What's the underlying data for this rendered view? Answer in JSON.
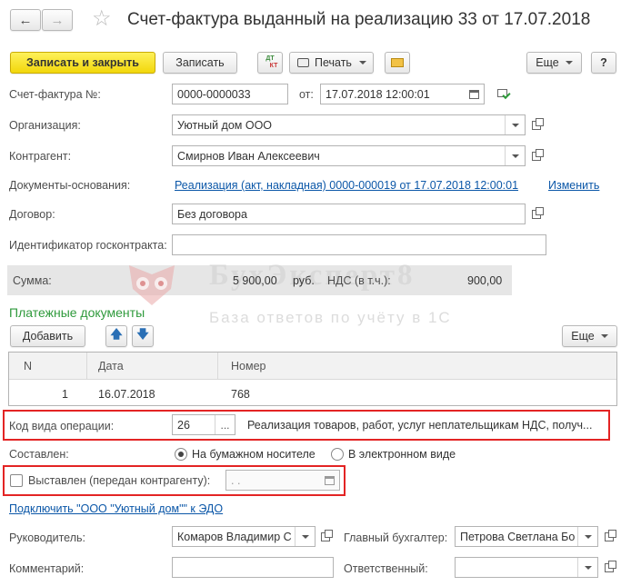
{
  "window": {
    "title": "Счет-фактура выданный на реализацию 33 от 17.07.2018"
  },
  "toolbar": {
    "save_close": "Записать и закрыть",
    "save": "Записать",
    "dt_kt_top": "ДТ",
    "dt_kt_bottom": "КТ",
    "print": "Печать",
    "more": "Еще",
    "help": "?"
  },
  "form": {
    "invoice_label": "Счет-фактура №:",
    "invoice_number": "0000-0000033",
    "date_label": "от:",
    "date_value": "17.07.2018 12:00:01",
    "org_label": "Организация:",
    "org_value": "Уютный дом ООО",
    "counterparty_label": "Контрагент:",
    "counterparty_value": "Смирнов Иван Алексеевич",
    "base_docs_label": "Документы-основания:",
    "base_docs_link": "Реализация (акт, накладная) 0000-000019 от 17.07.2018 12:00:01",
    "change_link": "Изменить",
    "contract_label": "Договор:",
    "contract_value": "Без договора",
    "gov_contract_label": "Идентификатор госконтракта:",
    "gov_contract_value": "",
    "sum_label": "Сумма:",
    "sum_value": "5 900,00",
    "sum_currency": "руб.",
    "vat_label": "НДС (в т.ч.):",
    "vat_value": "900,00"
  },
  "watermark": {
    "brand": "БухЭксперт8",
    "tagline": "База ответов по учёту в 1С"
  },
  "payments": {
    "title": "Платежные документы",
    "add": "Добавить",
    "more": "Еще",
    "columns": [
      "N",
      "Дата",
      "Номер"
    ],
    "rows": [
      {
        "n": "1",
        "date": "16.07.2018",
        "number": "768"
      }
    ]
  },
  "operation": {
    "code_label": "Код вида операции:",
    "code_value": "26",
    "code_select": "...",
    "code_description": "Реализация товаров, работ, услуг неплательщикам НДС, получ..."
  },
  "composed": {
    "label": "Составлен:",
    "paper": "На бумажном носителе",
    "electronic": "В электронном виде"
  },
  "issued": {
    "label": "Выставлен (передан контрагенту):",
    "date_placeholder": " .  ."
  },
  "edo_link": "Подключить \"ООО \"Уютный дом\"\" к ЭДО",
  "signers": {
    "head_label": "Руководитель:",
    "head_value": "Комаров Владимир С",
    "accountant_label": "Главный бухгалтер:",
    "accountant_value": "Петрова Светлана Бо",
    "comment_label": "Комментарий:",
    "comment_value": "",
    "responsible_label": "Ответственный:",
    "responsible_value": ""
  },
  "colors": {
    "accent_yellow": "#f5dc14",
    "link_blue": "#0b57a8",
    "section_green": "#2f9a3c",
    "highlight_red": "#e32424"
  }
}
